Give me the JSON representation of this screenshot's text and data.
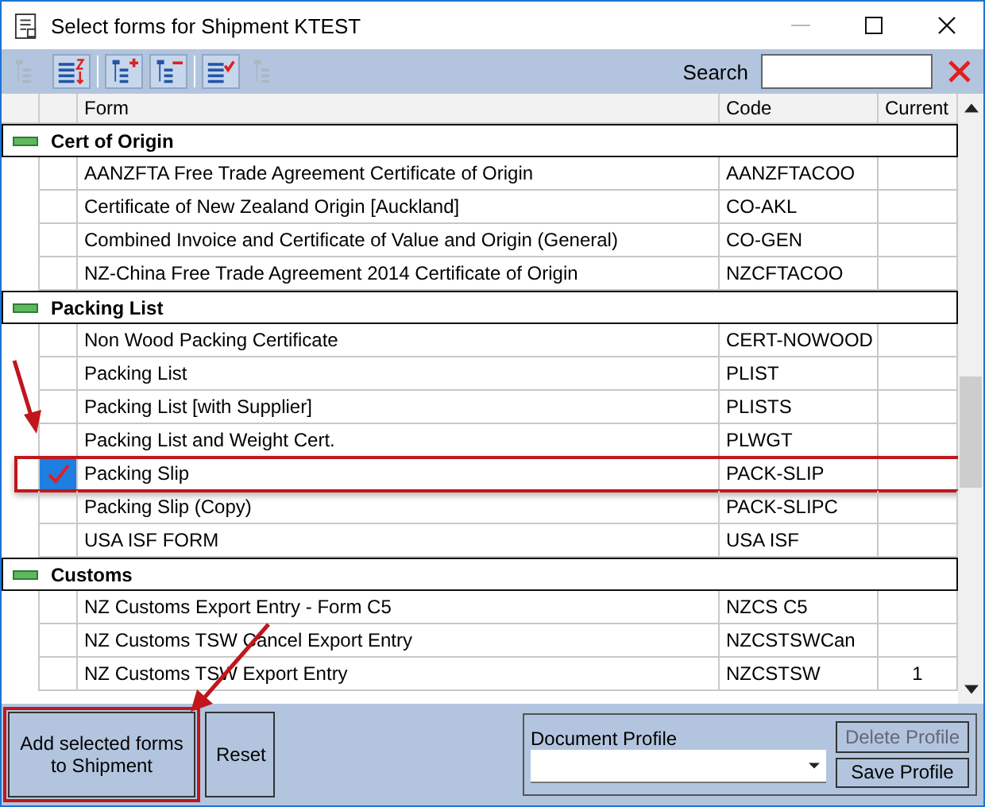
{
  "window": {
    "title": "Select forms for Shipment KTEST"
  },
  "toolbar": [
    {
      "kind": "tree",
      "disabled": true
    },
    {
      "kind": "sort",
      "disabled": false
    },
    {
      "kind": "expand",
      "disabled": false
    },
    {
      "kind": "collapse",
      "disabled": false
    },
    {
      "kind": "check",
      "disabled": false
    },
    {
      "kind": "all",
      "disabled": true
    }
  ],
  "search": {
    "label": "Search"
  },
  "table": {
    "columns": [
      "Form",
      "Code",
      "Current"
    ],
    "groups": [
      {
        "name": "Cert of Origin",
        "expanded": true,
        "rows": [
          {
            "form": "AANZFTA Free Trade Agreement Certificate of Origin",
            "code": "AANZFTACOO",
            "checked": false
          },
          {
            "form": "Certificate of New Zealand Origin [Auckland]",
            "code": "CO-AKL",
            "checked": false
          },
          {
            "form": "Combined Invoice and Certificate of Value and Origin (General)",
            "code": "CO-GEN",
            "checked": false
          },
          {
            "form": "NZ-China Free Trade Agreement 2014 Certificate of Origin",
            "code": "NZCFTACOO",
            "checked": false
          }
        ]
      },
      {
        "name": "Packing List",
        "expanded": true,
        "rows": [
          {
            "form": "Non Wood Packing Certificate",
            "code": "CERT-NOWOOD",
            "checked": false
          },
          {
            "form": "Packing List",
            "code": "PLIST",
            "checked": false
          },
          {
            "form": "Packing List [with Supplier]",
            "code": "PLISTS",
            "checked": false
          },
          {
            "form": "Packing List and Weight Cert.",
            "code": "PLWGT",
            "checked": false
          },
          {
            "form": "Packing Slip",
            "code": "PACK-SLIP",
            "checked": true
          },
          {
            "form": "Packing Slip (Copy)",
            "code": "PACK-SLIPC",
            "checked": false
          },
          {
            "form": "USA ISF FORM",
            "code": "USA ISF",
            "checked": false
          }
        ]
      },
      {
        "name": "Customs",
        "expanded": true,
        "rows": [
          {
            "form": "NZ Customs Export Entry - Form C5",
            "code": "NZCS C5",
            "checked": false
          },
          {
            "form": "NZ Customs TSW Cancel Export Entry",
            "code": "NZCSTSWCan",
            "checked": false
          },
          {
            "form": "NZ Customs TSW Export Entry",
            "code": "NZCSTSW",
            "current": "1",
            "checked": false
          }
        ]
      }
    ]
  },
  "buttons": {
    "add": "Add selected forms to Shipment",
    "reset": "Reset"
  },
  "profile": {
    "label": "Document Profile",
    "delete": {
      "label": "Delete Profile",
      "disabled": true
    },
    "save": {
      "label": "Save Profile",
      "disabled": false
    }
  }
}
